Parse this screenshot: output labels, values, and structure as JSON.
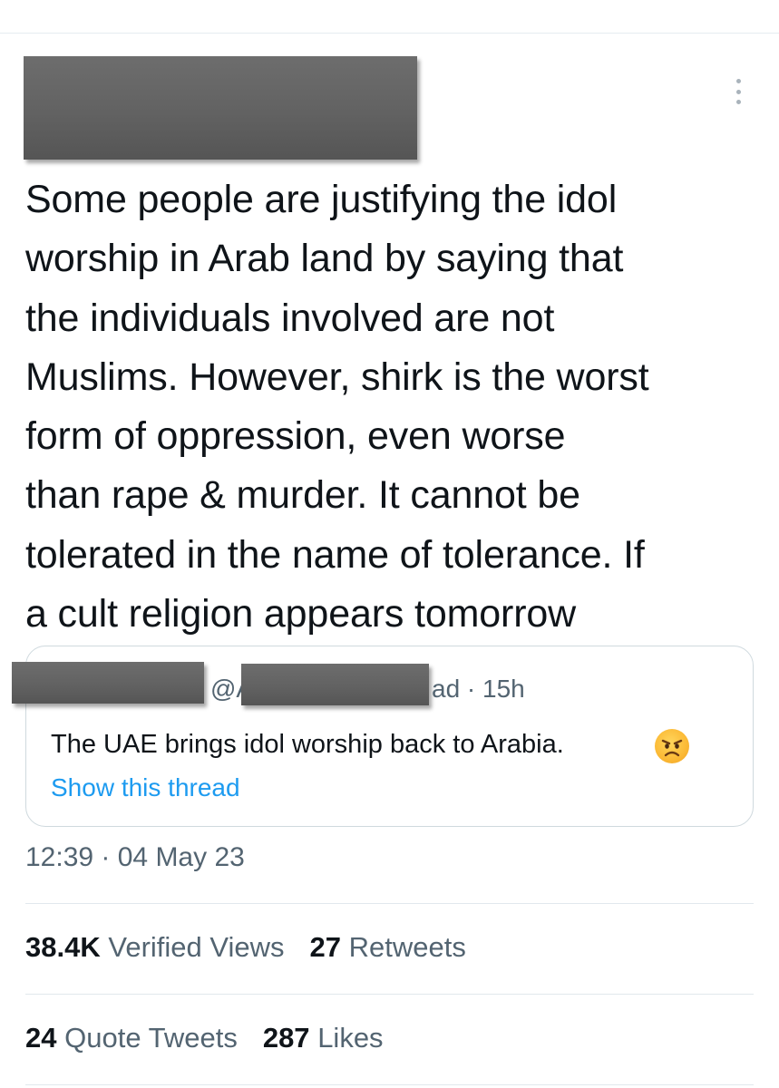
{
  "tweet": {
    "text": "Some people are justifying the idol\nworship in Arab land by saying that\nthe individuals involved are not\nMuslims. However, shirk is the worst\nform of oppression, even worse\nthan rape & murder. It cannot be\ntolerated in the name of tolerance. If\na cult religion appears tomorrow",
    "timestamp": "12:39 · 04 May 23"
  },
  "quoted_tweet": {
    "handle_prefix": "@A",
    "meta": "ad · 15h",
    "text": "The UAE brings idol worship back to Arabia.",
    "emoji_icon": "angry-face-icon",
    "show_thread": "Show this thread"
  },
  "stats": {
    "views_count": "38.4K",
    "views_label": "Verified Views",
    "retweets_count": "27",
    "retweets_label": "Retweets",
    "quotes_count": "24",
    "quotes_label": "Quote Tweets",
    "likes_count": "287",
    "likes_label": "Likes"
  },
  "colors": {
    "text": "#0f1419",
    "secondary": "#536471",
    "link": "#1d9bf0",
    "border": "#cfd9de",
    "redaction": "#626262"
  }
}
